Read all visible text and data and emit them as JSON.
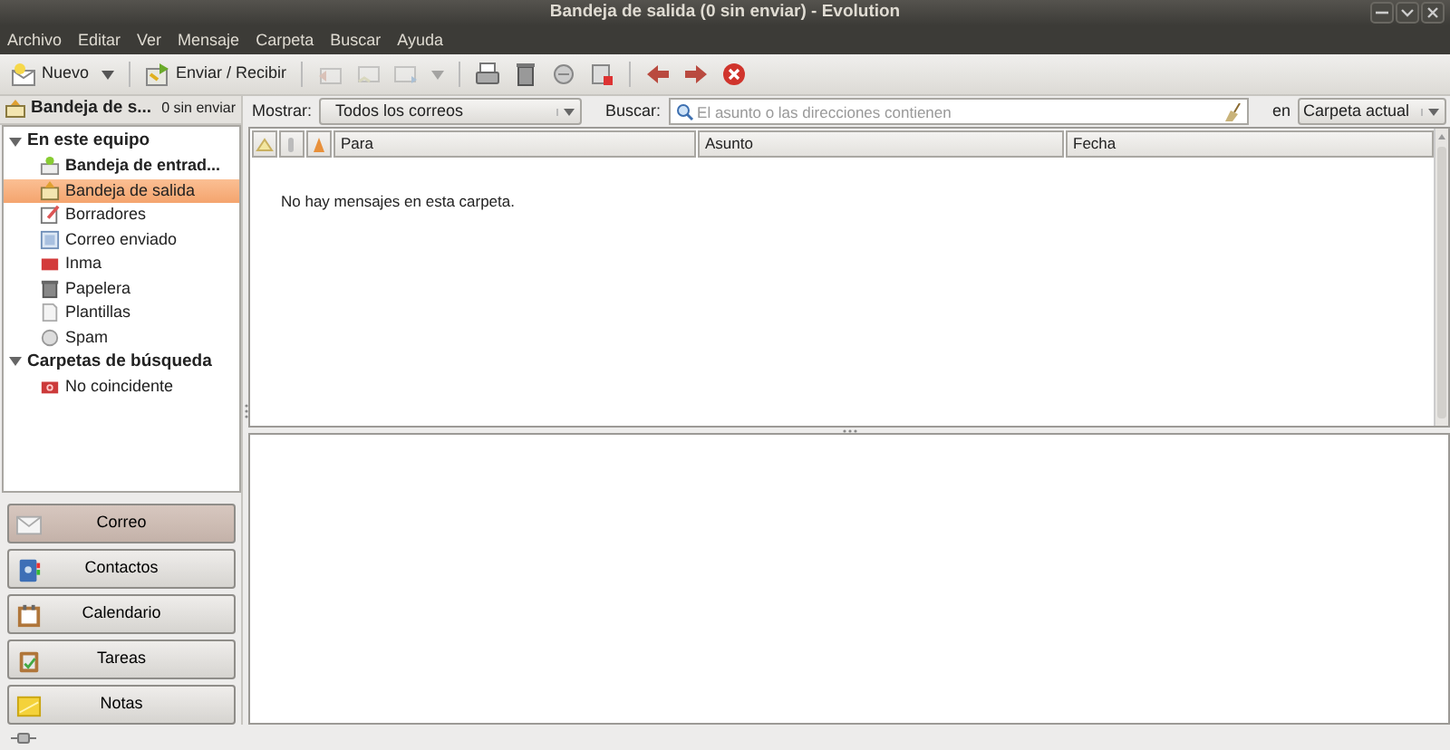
{
  "window": {
    "title": "Bandeja de salida (0 sin enviar) - Evolution"
  },
  "menu": [
    "Archivo",
    "Editar",
    "Ver",
    "Mensaje",
    "Carpeta",
    "Buscar",
    "Ayuda"
  ],
  "toolbar": [
    {
      "kind": "new",
      "label": "Nuevo",
      "disabled": false
    },
    {
      "kind": "caret",
      "disabled": false
    },
    {
      "kind": "sep"
    },
    {
      "kind": "sendrecv",
      "label": "Enviar / Recibir",
      "disabled": false
    },
    {
      "kind": "sep"
    },
    {
      "kind": "reply",
      "disabled": true
    },
    {
      "kind": "replyall",
      "disabled": true
    },
    {
      "kind": "forward",
      "disabled": true
    },
    {
      "kind": "caret",
      "disabled": true
    },
    {
      "kind": "sep"
    },
    {
      "kind": "print",
      "disabled": false
    },
    {
      "kind": "trash",
      "disabled": false
    },
    {
      "kind": "junk",
      "disabled": false
    },
    {
      "kind": "notjunk",
      "disabled": false
    },
    {
      "kind": "sep"
    },
    {
      "kind": "back",
      "disabled": false
    },
    {
      "kind": "next",
      "disabled": false
    },
    {
      "kind": "stop",
      "disabled": false
    }
  ],
  "folder_header": {
    "title": "Bandeja de s...",
    "count": "0 sin enviar"
  },
  "tree": [
    {
      "label": "En este equipo",
      "expanded": true,
      "children": [
        {
          "label": "Bandeja de entrad...",
          "kind": "inbox",
          "unread": true,
          "selected": false
        },
        {
          "label": "Bandeja de salida",
          "kind": "outbox",
          "unread": false,
          "selected": true
        },
        {
          "label": "Borradores",
          "kind": "drafts",
          "unread": false,
          "selected": false
        },
        {
          "label": "Correo enviado",
          "kind": "sent",
          "unread": false,
          "selected": false
        },
        {
          "label": "Inma",
          "kind": "folder",
          "unread": false,
          "selected": false
        },
        {
          "label": "Papelera",
          "kind": "trash",
          "unread": false,
          "selected": false
        },
        {
          "label": "Plantillas",
          "kind": "templates",
          "unread": false,
          "selected": false
        },
        {
          "label": "Spam",
          "kind": "junk",
          "unread": false,
          "selected": false
        }
      ]
    },
    {
      "label": "Carpetas de búsqueda",
      "expanded": true,
      "children": [
        {
          "label": "No coincidente",
          "kind": "vfolder",
          "unread": false,
          "selected": false
        }
      ]
    }
  ],
  "switcher": [
    {
      "label": "Correo",
      "kind": "mail",
      "selected": true
    },
    {
      "label": "Contactos",
      "kind": "contacts",
      "selected": false
    },
    {
      "label": "Calendario",
      "kind": "calendar",
      "selected": false
    },
    {
      "label": "Tareas",
      "kind": "tasks",
      "selected": false
    },
    {
      "label": "Notas",
      "kind": "memos",
      "selected": false
    }
  ],
  "filter": {
    "show_label": "Mostrar:",
    "show_value": "Todos los correos",
    "search_label": "Buscar:",
    "search_placeholder": "El asunto o las direcciones contienen",
    "scope_label": "en",
    "scope_value": "Carpeta actual"
  },
  "message_list": {
    "columns": [
      "Para",
      "Asunto",
      "Fecha"
    ],
    "empty_text": "No hay mensajes en esta carpeta."
  }
}
